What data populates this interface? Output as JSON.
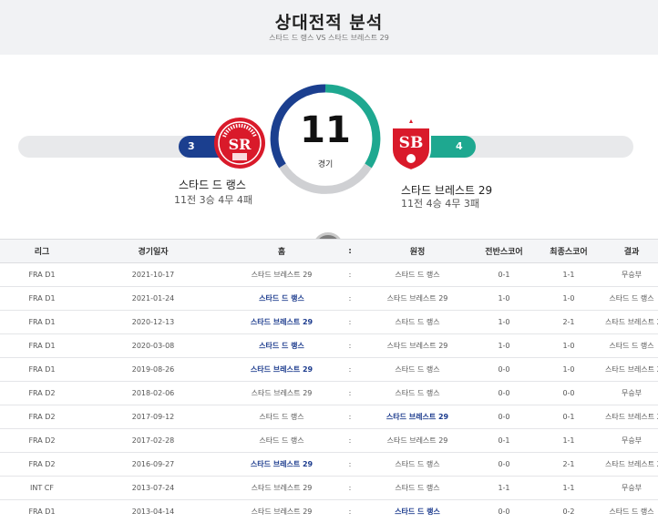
{
  "page": {
    "title": "상대전적 분석",
    "subtitle": "스타드 드 랭스 VS 스타드 브레스트 29"
  },
  "summary": {
    "total_games": "11",
    "games_label": "경기",
    "draws": "4무",
    "home": {
      "name": "스타드 드 랭스",
      "record": "11전 3승 4무 4패",
      "wins": "3",
      "color": "#1b3f8f",
      "logo_text": "SR"
    },
    "away": {
      "name": "스타드 브레스트 29",
      "record": "11전 4승 4무 3패",
      "wins": "4",
      "color": "#1ea890",
      "logo_text": "SB"
    }
  },
  "table": {
    "headers": [
      "리그",
      "경기일자",
      "홈",
      ":",
      "원정",
      "전반스코어",
      "최종스코어",
      "결과"
    ],
    "rows": [
      {
        "league": "FRA D1",
        "date": "2021-10-17",
        "home": "스타드 브레스트 29",
        "sep": ":",
        "away": "스타드 드 랭스",
        "half": "0-1",
        "final": "1-1",
        "result": "무승부",
        "bold": ""
      },
      {
        "league": "FRA D1",
        "date": "2021-01-24",
        "home": "스타드 드 랭스",
        "sep": ":",
        "away": "스타드 브레스트 29",
        "half": "1-0",
        "final": "1-0",
        "result": "스타드 드 랭스",
        "bold": "home"
      },
      {
        "league": "FRA D1",
        "date": "2020-12-13",
        "home": "스타드 브레스트 29",
        "sep": ":",
        "away": "스타드 드 랭스",
        "half": "1-0",
        "final": "2-1",
        "result": "스타드 브레스트 29",
        "bold": "home"
      },
      {
        "league": "FRA D1",
        "date": "2020-03-08",
        "home": "스타드 드 랭스",
        "sep": ":",
        "away": "스타드 브레스트 29",
        "half": "1-0",
        "final": "1-0",
        "result": "스타드 드 랭스",
        "bold": "home"
      },
      {
        "league": "FRA D1",
        "date": "2019-08-26",
        "home": "스타드 브레스트 29",
        "sep": ":",
        "away": "스타드 드 랭스",
        "half": "0-0",
        "final": "1-0",
        "result": "스타드 브레스트 29",
        "bold": "home"
      },
      {
        "league": "FRA D2",
        "date": "2018-02-06",
        "home": "스타드 브레스트 29",
        "sep": ":",
        "away": "스타드 드 랭스",
        "half": "0-0",
        "final": "0-0",
        "result": "무승부",
        "bold": ""
      },
      {
        "league": "FRA D2",
        "date": "2017-09-12",
        "home": "스타드 드 랭스",
        "sep": ":",
        "away": "스타드 브레스트 29",
        "half": "0-0",
        "final": "0-1",
        "result": "스타드 브레스트 29",
        "bold": "away"
      },
      {
        "league": "FRA D2",
        "date": "2017-02-28",
        "home": "스타드 드 랭스",
        "sep": ":",
        "away": "스타드 브레스트 29",
        "half": "0-1",
        "final": "1-1",
        "result": "무승부",
        "bold": ""
      },
      {
        "league": "FRA D2",
        "date": "2016-09-27",
        "home": "스타드 브레스트 29",
        "sep": ":",
        "away": "스타드 드 랭스",
        "half": "0-0",
        "final": "2-1",
        "result": "스타드 브레스트 29",
        "bold": "home"
      },
      {
        "league": "INT CF",
        "date": "2013-07-24",
        "home": "스타드 브레스트 29",
        "sep": ":",
        "away": "스타드 드 랭스",
        "half": "1-1",
        "final": "1-1",
        "result": "무승부",
        "bold": ""
      },
      {
        "league": "FRA D1",
        "date": "2013-04-14",
        "home": "스타드 브레스트 29",
        "sep": ":",
        "away": "스타드 드 랭스",
        "half": "0-0",
        "final": "0-2",
        "result": "스타드 드 랭스",
        "bold": "away"
      }
    ]
  }
}
